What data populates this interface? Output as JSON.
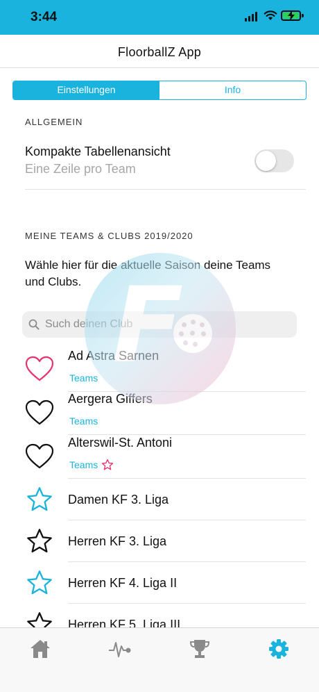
{
  "status_bar": {
    "time": "3:44"
  },
  "nav": {
    "title": "FloorballZ App"
  },
  "segments": {
    "settings": "Einstellungen",
    "info": "Info"
  },
  "general": {
    "header": "ALLGEMEIN",
    "compact_title": "Kompakte Tabellenansicht",
    "compact_subtitle": "Eine Zeile pro Team",
    "compact_enabled": false
  },
  "teams_section": {
    "header": "MEINE TEAMS & CLUBS 2019/2020",
    "description": "Wähle hier für die aktuelle Saison deine Teams und Clubs."
  },
  "search": {
    "placeholder": "Such deinen Club"
  },
  "clubs": [
    {
      "name": "Ad Astra Sarnen",
      "link": "Teams",
      "favorite": true
    },
    {
      "name": "Aergera Giffers",
      "link": "Teams",
      "favorite": false
    },
    {
      "name": "Alterswil-St. Antoni",
      "link": "Teams",
      "favorite": false
    }
  ],
  "leagues": [
    {
      "name": "Damen KF 3. Liga",
      "starred": true
    },
    {
      "name": "Herren KF 3. Liga",
      "starred": false
    },
    {
      "name": "Herren KF 4. Liga II",
      "starred": true
    },
    {
      "name": "Herren KF 5. Liga III",
      "starred": false
    }
  ],
  "colors": {
    "accent": "#1ab3de",
    "favorite_pink": "#e8336f",
    "muted_text": "#a6a6a6",
    "tab_inactive": "#8a8a8a"
  },
  "tabs": [
    {
      "icon": "home-icon",
      "active": false
    },
    {
      "icon": "pulse-icon",
      "active": false
    },
    {
      "icon": "trophy-icon",
      "active": false
    },
    {
      "icon": "gear-icon",
      "active": true
    }
  ]
}
